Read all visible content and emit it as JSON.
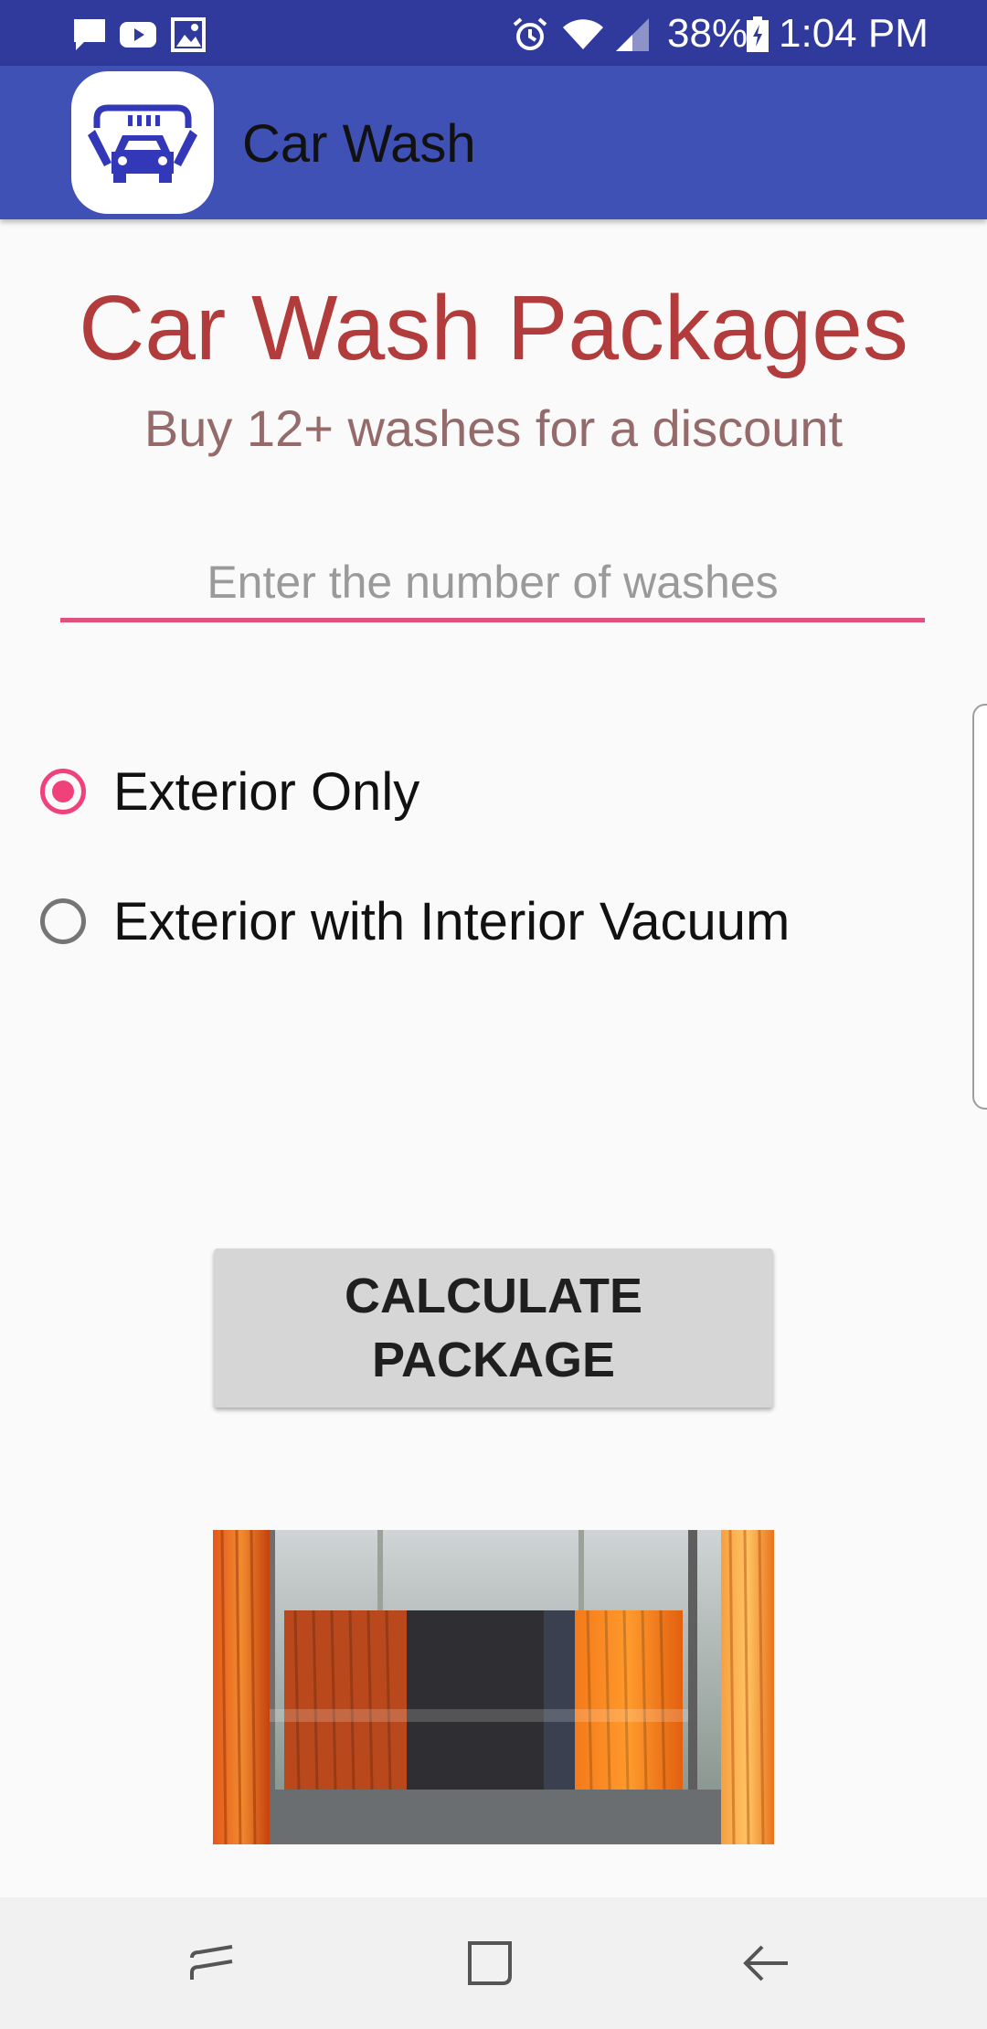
{
  "status_bar": {
    "battery_text": "38%",
    "time": "1:04 PM",
    "left_icons": [
      "message-icon",
      "youtube-icon",
      "gallery-icon"
    ],
    "right_icons": [
      "alarm-icon",
      "wifi-icon",
      "signal-icon",
      "battery-icon"
    ]
  },
  "app_bar": {
    "title": "Car Wash",
    "icon": "car-wash-icon"
  },
  "main": {
    "heading": "Car Wash Packages",
    "subheading": "Buy 12+ washes for a discount",
    "washes_input": {
      "placeholder": "Enter the number of washes",
      "value": ""
    },
    "options": [
      {
        "label": "Exterior Only",
        "selected": true
      },
      {
        "label": "Exterior with Interior Vacuum",
        "selected": false
      }
    ],
    "calculate_button": "CALCULATE PACKAGE",
    "image": "car-wash-brushes-photo"
  },
  "nav_bar": {
    "buttons": [
      "recent-apps-icon",
      "home-icon",
      "back-icon"
    ]
  },
  "colors": {
    "status_bar": "#30399c",
    "app_bar": "#3f51b5",
    "heading": "#b23b3b",
    "subheading": "#946a6a",
    "accent": "#f0417a",
    "button": "#d6d6d6"
  }
}
